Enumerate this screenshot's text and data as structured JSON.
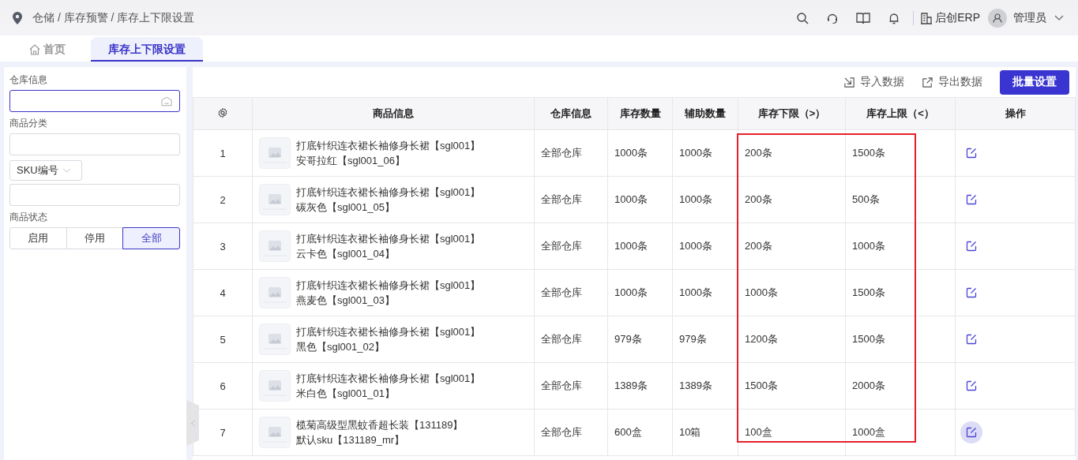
{
  "breadcrumb": "仓储 / 库存预警 / 库存上下限设置",
  "header": {
    "company": "启创ERP",
    "user": "管理员"
  },
  "tabs": [
    {
      "label": "首页",
      "selected": false,
      "kind": "home"
    },
    {
      "label": "库存上下限设置",
      "selected": true,
      "kind": "page"
    }
  ],
  "filters": {
    "warehouse_label": "仓库信息",
    "category_label": "商品分类",
    "sku_select": "SKU编号",
    "status_label": "商品状态",
    "status_options": [
      {
        "label": "启用",
        "selected": false
      },
      {
        "label": "停用",
        "selected": false
      },
      {
        "label": "全部",
        "selected": true
      }
    ]
  },
  "toolbar": {
    "import": "导入数据",
    "export": "导出数据",
    "batch": "批量设置"
  },
  "table": {
    "columns": [
      "商品信息",
      "仓库信息",
      "库存数量",
      "辅助数量",
      "库存下限（>）",
      "库存上限（<）",
      "操作"
    ],
    "highlight_limits": true,
    "rows": [
      {
        "index": "1",
        "name": "打底针织连衣裙长袖修身长裙【sgl001】",
        "variant": "安哥拉红【sgl001_06】",
        "warehouse": "全部仓库",
        "stock": "1000条",
        "aux": "1000条",
        "lower": "200条",
        "upper": "1500条",
        "edit_hovered": false
      },
      {
        "index": "2",
        "name": "打底针织连衣裙长袖修身长裙【sgl001】",
        "variant": "碳灰色【sgl001_05】",
        "warehouse": "全部仓库",
        "stock": "1000条",
        "aux": "1000条",
        "lower": "200条",
        "upper": "500条",
        "edit_hovered": false
      },
      {
        "index": "3",
        "name": "打底针织连衣裙长袖修身长裙【sgl001】",
        "variant": "云卡色【sgl001_04】",
        "warehouse": "全部仓库",
        "stock": "1000条",
        "aux": "1000条",
        "lower": "200条",
        "upper": "1000条",
        "edit_hovered": false
      },
      {
        "index": "4",
        "name": "打底针织连衣裙长袖修身长裙【sgl001】",
        "variant": "燕麦色【sgl001_03】",
        "warehouse": "全部仓库",
        "stock": "1000条",
        "aux": "1000条",
        "lower": "1000条",
        "upper": "1500条",
        "edit_hovered": false
      },
      {
        "index": "5",
        "name": "打底针织连衣裙长袖修身长裙【sgl001】",
        "variant": "黑色【sgl001_02】",
        "warehouse": "全部仓库",
        "stock": "979条",
        "aux": "979条",
        "lower": "1200条",
        "upper": "1500条",
        "edit_hovered": false
      },
      {
        "index": "6",
        "name": "打底针织连衣裙长袖修身长裙【sgl001】",
        "variant": "米白色【sgl001_01】",
        "warehouse": "全部仓库",
        "stock": "1389条",
        "aux": "1389条",
        "lower": "1500条",
        "upper": "2000条",
        "edit_hovered": false
      },
      {
        "index": "7",
        "name": "榄菊高级型黑蚊香超长装【131189】",
        "variant": "默认sku【131189_mr】",
        "warehouse": "全部仓库",
        "stock": "600盒",
        "aux": "10箱",
        "lower": "100盒",
        "upper": "1000盒",
        "edit_hovered": true
      }
    ]
  }
}
